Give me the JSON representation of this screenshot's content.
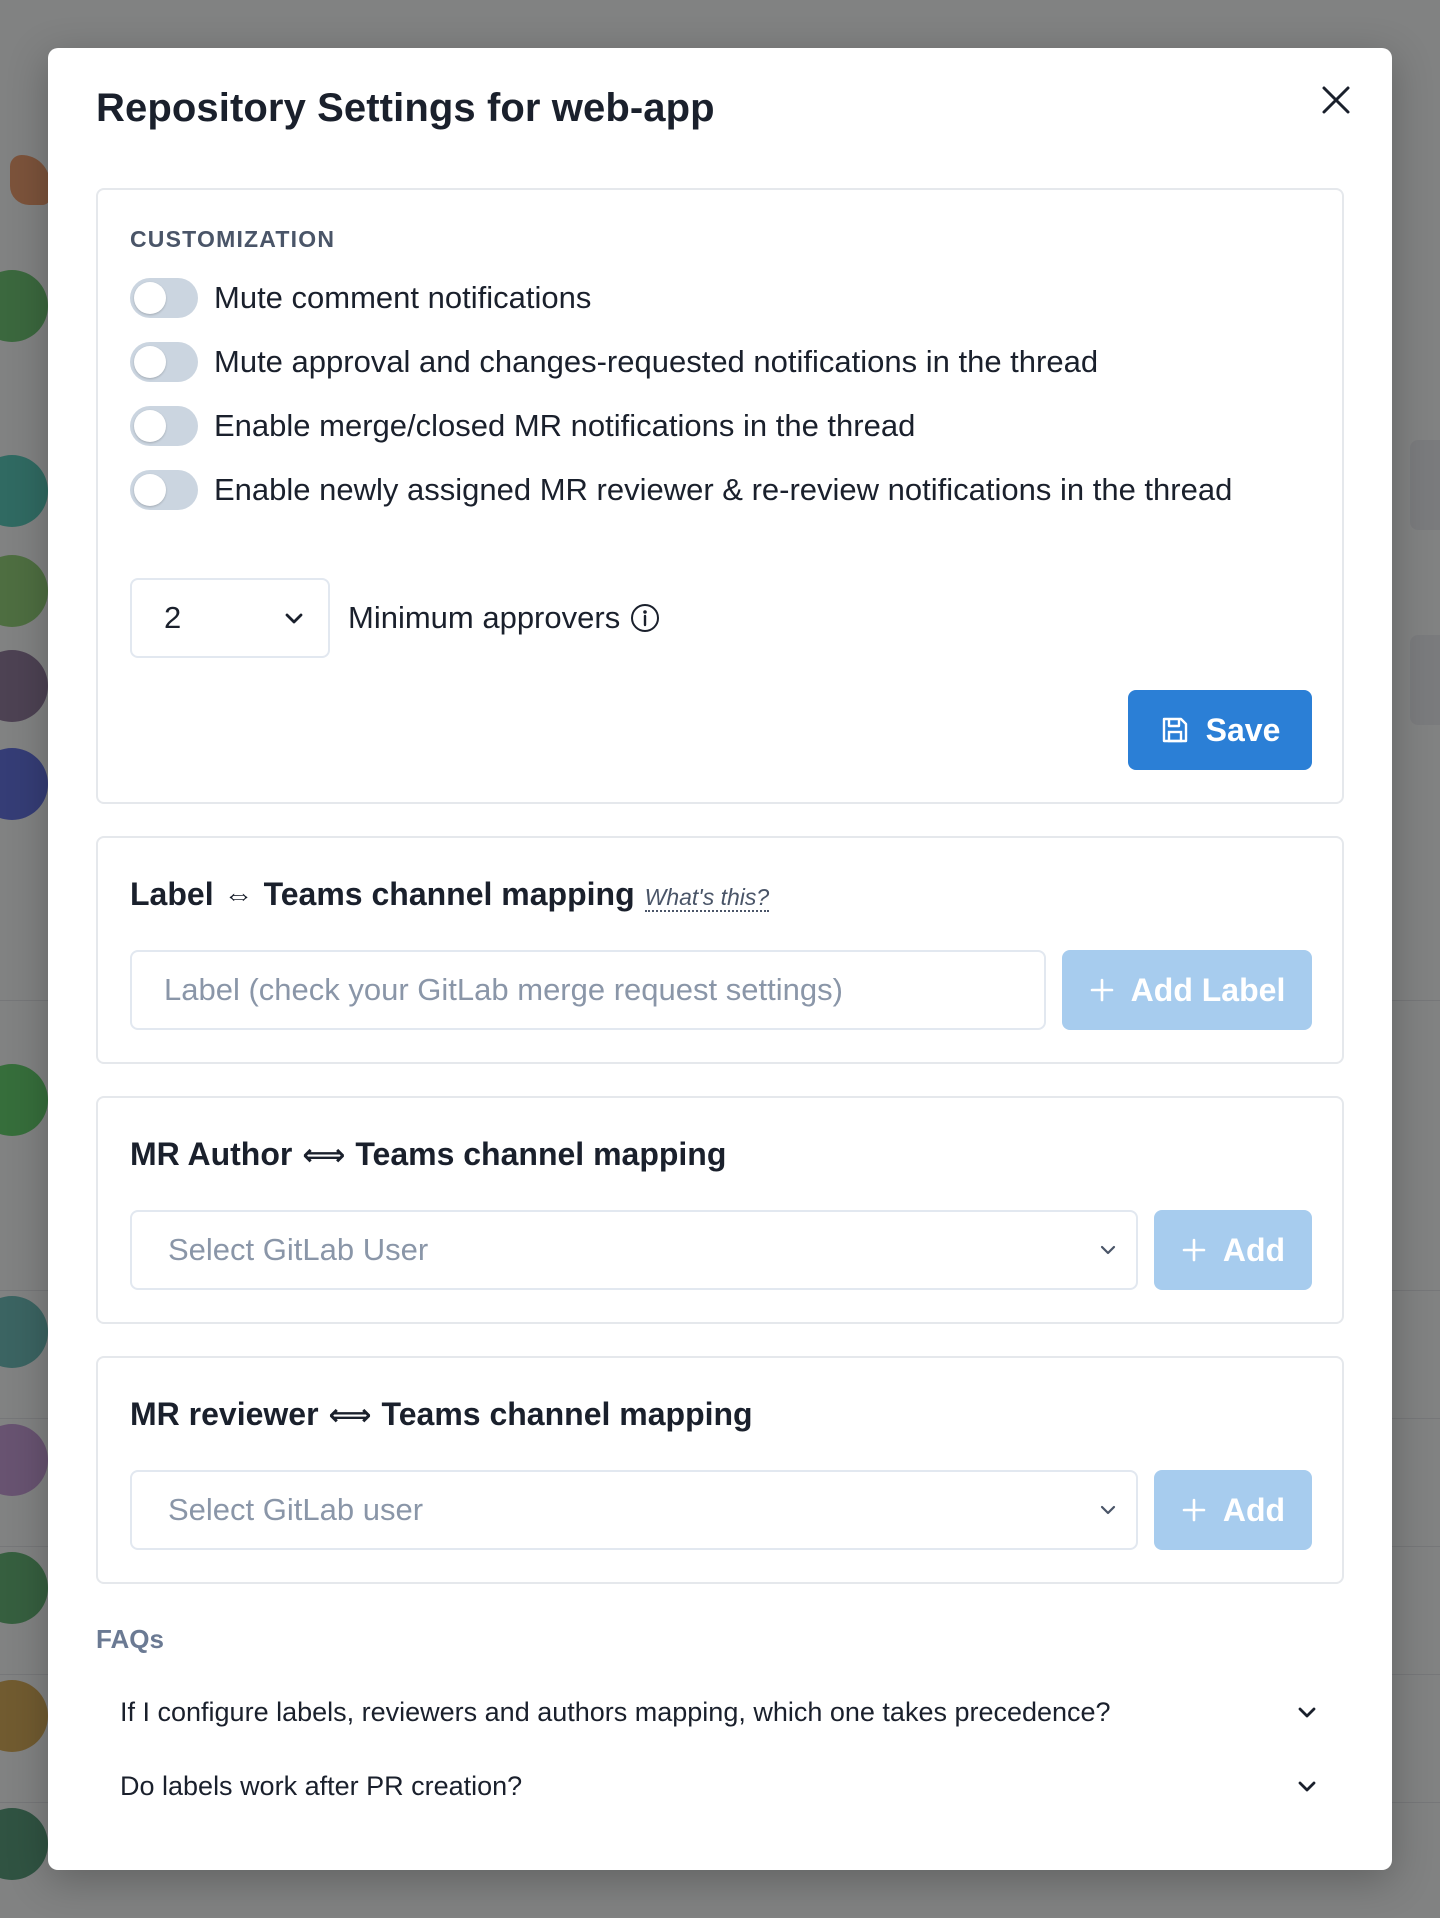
{
  "modal": {
    "title": "Repository Settings for web-app"
  },
  "customization": {
    "section_label": "CUSTOMIZATION",
    "toggles": [
      {
        "label": "Mute comment notifications",
        "on": false
      },
      {
        "label": "Mute approval and changes-requested notifications in the thread",
        "on": false
      },
      {
        "label": "Enable merge/closed MR notifications in the thread",
        "on": false
      },
      {
        "label": "Enable newly assigned MR reviewer & re-review notifications in the thread",
        "on": false
      }
    ],
    "min_approvers_value": "2",
    "min_approvers_label": "Minimum approvers",
    "save_label": "Save"
  },
  "label_mapping": {
    "title_left": "Label",
    "arrow": "⇔",
    "title_right": "Teams channel mapping",
    "whats_this": "What's this?",
    "input_placeholder": "Label (check your GitLab merge request settings)",
    "add_label": "Add Label"
  },
  "author_mapping": {
    "title_left": "MR Author",
    "arrow": "⟺",
    "title_right": "Teams channel mapping",
    "select_placeholder": "Select GitLab User",
    "add_label": "Add"
  },
  "reviewer_mapping": {
    "title_left": "MR reviewer",
    "arrow": "⟺",
    "title_right": "Teams channel mapping",
    "select_placeholder": "Select GitLab user",
    "add_label": "Add"
  },
  "faqs": {
    "title": "FAQs",
    "items": [
      {
        "question": "If I configure labels, reviewers and authors mapping, which one takes precedence?"
      },
      {
        "question": "Do labels work after PR creation?"
      }
    ]
  },
  "colors": {
    "primary": "#2b7fd6",
    "primary_disabled": "#a7ccee",
    "toggle_off": "#cbd5e0"
  }
}
